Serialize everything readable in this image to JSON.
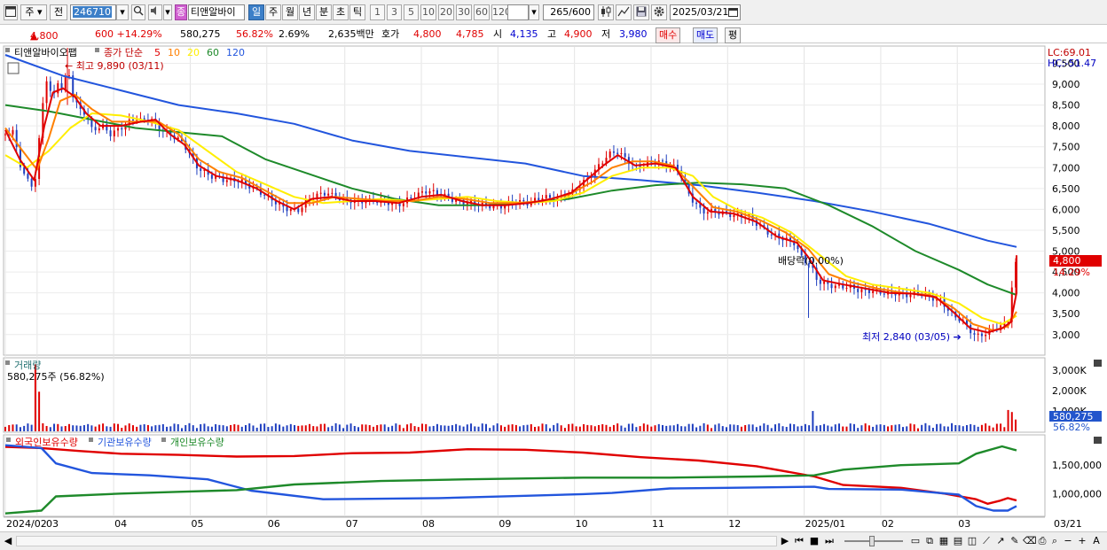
{
  "toolbar": {
    "period_type": "주",
    "prev_label": "전",
    "stock_code": "246710",
    "stock_name": "티앤알바이",
    "timeframes": [
      "일",
      "주",
      "월",
      "년",
      "분",
      "초",
      "틱"
    ],
    "active_timeframe": "일",
    "intervals": [
      "1",
      "3",
      "5",
      "10",
      "20",
      "30",
      "60",
      "120"
    ],
    "count": "265",
    "count_total": "/600",
    "date": "2025/03/21",
    "jong_label": "종"
  },
  "quote": {
    "price": "4,800",
    "change": "600 +14.29%",
    "volume": "580,275",
    "volume_pct": "56.82%",
    "turnover_pct": "2.69%",
    "amount": "2,635백만",
    "hoga_label": "호가",
    "ask": "4,800",
    "bid": "4,785",
    "open_label": "시",
    "open": "4,135",
    "high_label": "고",
    "high": "4,900",
    "low_label": "저",
    "low": "3,980",
    "buy_label": "매수",
    "sell_label": "매도",
    "eval_label": "평"
  },
  "price_panel": {
    "title": "티앤알바이오팹",
    "ma_label": "종가 단순",
    "ma_periods": [
      "5",
      "10",
      "20",
      "60",
      "120"
    ],
    "ma_colors": [
      "#e00000",
      "#ff8000",
      "#ffee00",
      "#1e8a2a",
      "#2255dd"
    ],
    "lc": "LC:69.01",
    "hc": "HC:-51.47",
    "high_annotation": "최고 9,890 (03/11)",
    "low_annotation": "최저 2,840 (03/05)",
    "dividend_annotation": "배당락(0.00%)",
    "current_tag": "4,800",
    "current_pct": "14.29%",
    "y_ticks": [
      "9,500",
      "9,000",
      "8,500",
      "8,000",
      "7,500",
      "7,000",
      "6,500",
      "6,000",
      "5,500",
      "5,000",
      "4,500",
      "4,000",
      "3,500",
      "3,000"
    ]
  },
  "volume_panel": {
    "title": "거래량",
    "subtitle": "580,275주 (56.82%)",
    "y_ticks": [
      "3,000K",
      "2,000K",
      "1,000K"
    ],
    "current_tag": "580,275",
    "current_pct": "56.82%"
  },
  "holder_panel": {
    "series": [
      "외국인보유수량",
      "기관보유수량",
      "개인보유수량"
    ],
    "series_colors": [
      "#e00000",
      "#2255dd",
      "#1e8a2a"
    ],
    "y_ticks": [
      "1,500,000",
      "1,000,000"
    ]
  },
  "x_axis": {
    "labels": [
      "2024/02",
      "03",
      "04",
      "05",
      "06",
      "07",
      "08",
      "09",
      "10",
      "11",
      "12",
      "2025/01",
      "02",
      "03"
    ],
    "right_label": "03/21"
  },
  "chart_data": {
    "type": "line",
    "xlabel": "",
    "ylabel": "",
    "price_range": [
      2550,
      9870
    ],
    "volume_range": [
      0,
      3400
    ],
    "holder_range": [
      630000,
      1970000
    ],
    "price_close": [
      [
        0,
        7800
      ],
      [
        5,
        7900
      ],
      [
        10,
        7100
      ],
      [
        15,
        6700
      ],
      [
        20,
        6500
      ],
      [
        25,
        8200
      ],
      [
        28,
        9200
      ],
      [
        33,
        8600
      ],
      [
        36,
        9100
      ],
      [
        40,
        8800
      ],
      [
        43,
        9450
      ],
      [
        47,
        8700
      ],
      [
        51,
        8400
      ],
      [
        56,
        8300
      ],
      [
        60,
        7900
      ],
      [
        67,
        8000
      ],
      [
        73,
        7800
      ],
      [
        82,
        8000
      ],
      [
        90,
        8200
      ],
      [
        95,
        8100
      ],
      [
        100,
        8200
      ],
      [
        106,
        7950
      ],
      [
        114,
        7800
      ],
      [
        123,
        7600
      ],
      [
        133,
        7000
      ],
      [
        142,
        6800
      ],
      [
        152,
        6700
      ],
      [
        162,
        6700
      ],
      [
        172,
        6500
      ],
      [
        182,
        6300
      ],
      [
        192,
        6050
      ],
      [
        202,
        5950
      ],
      [
        212,
        6300
      ],
      [
        222,
        6400
      ],
      [
        232,
        6250
      ],
      [
        242,
        6200
      ],
      [
        252,
        6200
      ],
      [
        262,
        6200
      ],
      [
        272,
        6100
      ],
      [
        282,
        6300
      ],
      [
        292,
        6450
      ],
      [
        302,
        6350
      ],
      [
        312,
        6200
      ],
      [
        322,
        6150
      ],
      [
        332,
        6100
      ],
      [
        342,
        6050
      ],
      [
        352,
        6200
      ],
      [
        362,
        6150
      ],
      [
        372,
        6300
      ],
      [
        382,
        6250
      ],
      [
        392,
        6400
      ],
      [
        402,
        6700
      ],
      [
        410,
        7000
      ],
      [
        417,
        7300
      ],
      [
        423,
        7400
      ],
      [
        430,
        7200
      ],
      [
        436,
        7000
      ],
      [
        442,
        7050
      ],
      [
        450,
        7150
      ],
      [
        458,
        7100
      ],
      [
        466,
        6950
      ],
      [
        474,
        6300
      ],
      [
        482,
        5950
      ],
      [
        490,
        5950
      ],
      [
        498,
        5900
      ],
      [
        506,
        5850
      ],
      [
        514,
        5850
      ],
      [
        522,
        5600
      ],
      [
        530,
        5400
      ],
      [
        538,
        5300
      ],
      [
        546,
        5200
      ],
      [
        552,
        4800
      ],
      [
        557,
        4700
      ],
      [
        562,
        4300
      ],
      [
        568,
        4200
      ],
      [
        576,
        4150
      ],
      [
        584,
        4150
      ],
      [
        592,
        4050
      ],
      [
        600,
        4050
      ],
      [
        608,
        4000
      ],
      [
        616,
        4000
      ],
      [
        624,
        3950
      ],
      [
        632,
        4000
      ],
      [
        640,
        3900
      ],
      [
        648,
        3800
      ],
      [
        656,
        3450
      ],
      [
        662,
        3350
      ],
      [
        668,
        3100
      ],
      [
        672,
        2950
      ],
      [
        676,
        3000
      ],
      [
        680,
        3050
      ],
      [
        685,
        3150
      ],
      [
        690,
        3200
      ],
      [
        694,
        3300
      ],
      [
        697,
        4200
      ],
      [
        700,
        4800
      ]
    ],
    "ma5": [
      [
        0,
        7900
      ],
      [
        10,
        7200
      ],
      [
        20,
        6700
      ],
      [
        27,
        8000
      ],
      [
        33,
        8800
      ],
      [
        40,
        8900
      ],
      [
        48,
        8700
      ],
      [
        56,
        8300
      ],
      [
        66,
        8000
      ],
      [
        80,
        8000
      ],
      [
        94,
        8100
      ],
      [
        104,
        8150
      ],
      [
        114,
        7800
      ],
      [
        124,
        7550
      ],
      [
        134,
        7050
      ],
      [
        146,
        6800
      ],
      [
        160,
        6700
      ],
      [
        174,
        6500
      ],
      [
        188,
        6200
      ],
      [
        200,
        6000
      ],
      [
        212,
        6250
      ],
      [
        226,
        6300
      ],
      [
        240,
        6200
      ],
      [
        256,
        6200
      ],
      [
        272,
        6150
      ],
      [
        288,
        6300
      ],
      [
        302,
        6350
      ],
      [
        316,
        6200
      ],
      [
        330,
        6100
      ],
      [
        346,
        6100
      ],
      [
        362,
        6150
      ],
      [
        378,
        6250
      ],
      [
        392,
        6400
      ],
      [
        404,
        6750
      ],
      [
        414,
        7050
      ],
      [
        424,
        7300
      ],
      [
        436,
        7050
      ],
      [
        450,
        7100
      ],
      [
        464,
        7000
      ],
      [
        476,
        6300
      ],
      [
        488,
        5950
      ],
      [
        504,
        5900
      ],
      [
        520,
        5700
      ],
      [
        534,
        5350
      ],
      [
        548,
        5200
      ],
      [
        556,
        4850
      ],
      [
        566,
        4300
      ],
      [
        580,
        4200
      ],
      [
        596,
        4100
      ],
      [
        612,
        4000
      ],
      [
        628,
        3980
      ],
      [
        644,
        3900
      ],
      [
        656,
        3550
      ],
      [
        668,
        3150
      ],
      [
        680,
        3050
      ],
      [
        690,
        3150
      ],
      [
        696,
        3300
      ],
      [
        700,
        4000
      ]
    ],
    "ma10": [
      [
        0,
        7950
      ],
      [
        12,
        7400
      ],
      [
        22,
        6950
      ],
      [
        30,
        7700
      ],
      [
        38,
        8600
      ],
      [
        48,
        8750
      ],
      [
        60,
        8400
      ],
      [
        74,
        8100
      ],
      [
        90,
        8100
      ],
      [
        106,
        8100
      ],
      [
        120,
        7800
      ],
      [
        134,
        7200
      ],
      [
        148,
        6900
      ],
      [
        164,
        6750
      ],
      [
        180,
        6450
      ],
      [
        196,
        6150
      ],
      [
        212,
        6150
      ],
      [
        228,
        6300
      ],
      [
        246,
        6250
      ],
      [
        264,
        6200
      ],
      [
        282,
        6200
      ],
      [
        300,
        6300
      ],
      [
        318,
        6250
      ],
      [
        336,
        6150
      ],
      [
        354,
        6150
      ],
      [
        372,
        6200
      ],
      [
        390,
        6350
      ],
      [
        406,
        6650
      ],
      [
        420,
        7000
      ],
      [
        434,
        7150
      ],
      [
        448,
        7150
      ],
      [
        462,
        7050
      ],
      [
        476,
        6550
      ],
      [
        490,
        6050
      ],
      [
        506,
        5950
      ],
      [
        522,
        5750
      ],
      [
        540,
        5450
      ],
      [
        556,
        5050
      ],
      [
        570,
        4450
      ],
      [
        586,
        4250
      ],
      [
        604,
        4100
      ],
      [
        622,
        4000
      ],
      [
        640,
        3950
      ],
      [
        656,
        3650
      ],
      [
        670,
        3250
      ],
      [
        684,
        3100
      ],
      [
        694,
        3200
      ],
      [
        700,
        3550
      ]
    ],
    "ma20": [
      [
        0,
        7300
      ],
      [
        15,
        7000
      ],
      [
        30,
        7400
      ],
      [
        45,
        7950
      ],
      [
        60,
        8300
      ],
      [
        80,
        8250
      ],
      [
        100,
        8100
      ],
      [
        120,
        7900
      ],
      [
        140,
        7400
      ],
      [
        160,
        6900
      ],
      [
        180,
        6600
      ],
      [
        200,
        6300
      ],
      [
        220,
        6150
      ],
      [
        240,
        6200
      ],
      [
        260,
        6250
      ],
      [
        280,
        6200
      ],
      [
        300,
        6250
      ],
      [
        320,
        6300
      ],
      [
        340,
        6200
      ],
      [
        360,
        6150
      ],
      [
        380,
        6200
      ],
      [
        400,
        6400
      ],
      [
        420,
        6800
      ],
      [
        440,
        7000
      ],
      [
        460,
        7000
      ],
      [
        476,
        6800
      ],
      [
        490,
        6300
      ],
      [
        506,
        6000
      ],
      [
        524,
        5800
      ],
      [
        544,
        5450
      ],
      [
        564,
        4900
      ],
      [
        582,
        4400
      ],
      [
        600,
        4200
      ],
      [
        620,
        4100
      ],
      [
        640,
        4000
      ],
      [
        660,
        3750
      ],
      [
        676,
        3400
      ],
      [
        690,
        3250
      ],
      [
        700,
        3450
      ]
    ],
    "ma60": [
      [
        0,
        8500
      ],
      [
        30,
        8350
      ],
      [
        60,
        8150
      ],
      [
        90,
        7950
      ],
      [
        120,
        7850
      ],
      [
        150,
        7750
      ],
      [
        180,
        7200
      ],
      [
        210,
        6850
      ],
      [
        240,
        6500
      ],
      [
        270,
        6250
      ],
      [
        300,
        6100
      ],
      [
        330,
        6100
      ],
      [
        360,
        6150
      ],
      [
        390,
        6250
      ],
      [
        420,
        6450
      ],
      [
        450,
        6580
      ],
      [
        480,
        6640
      ],
      [
        510,
        6600
      ],
      [
        540,
        6500
      ],
      [
        570,
        6100
      ],
      [
        600,
        5600
      ],
      [
        630,
        5000
      ],
      [
        660,
        4550
      ],
      [
        680,
        4200
      ],
      [
        700,
        3950
      ]
    ],
    "ma120": [
      [
        0,
        9700
      ],
      [
        40,
        9200
      ],
      [
        80,
        8850
      ],
      [
        120,
        8500
      ],
      [
        160,
        8300
      ],
      [
        200,
        8050
      ],
      [
        240,
        7650
      ],
      [
        280,
        7400
      ],
      [
        320,
        7250
      ],
      [
        360,
        7100
      ],
      [
        400,
        6800
      ],
      [
        440,
        6700
      ],
      [
        480,
        6580
      ],
      [
        520,
        6400
      ],
      [
        560,
        6200
      ],
      [
        600,
        5950
      ],
      [
        640,
        5650
      ],
      [
        680,
        5250
      ],
      [
        700,
        5100
      ]
    ],
    "volume_spikes": [
      [
        21,
        3300
      ],
      [
        24,
        1950
      ],
      [
        558,
        1000
      ],
      [
        656,
        400
      ],
      [
        694,
        1050
      ],
      [
        697,
        950
      ],
      [
        700,
        580
      ]
    ],
    "foreign_holding": [
      [
        0,
        1820
      ],
      [
        25,
        1800
      ],
      [
        50,
        1750
      ],
      [
        80,
        1700
      ],
      [
        120,
        1680
      ],
      [
        160,
        1650
      ],
      [
        200,
        1660
      ],
      [
        240,
        1710
      ],
      [
        280,
        1720
      ],
      [
        320,
        1780
      ],
      [
        360,
        1770
      ],
      [
        400,
        1720
      ],
      [
        440,
        1640
      ],
      [
        480,
        1580
      ],
      [
        520,
        1480
      ],
      [
        560,
        1300
      ],
      [
        580,
        1150
      ],
      [
        620,
        1100
      ],
      [
        650,
        1000
      ],
      [
        672,
        900
      ],
      [
        680,
        820
      ],
      [
        688,
        870
      ],
      [
        694,
        920
      ],
      [
        700,
        880
      ]
    ],
    "institution_holding": [
      [
        0,
        1850
      ],
      [
        25,
        1800
      ],
      [
        35,
        1530
      ],
      [
        60,
        1360
      ],
      [
        100,
        1320
      ],
      [
        140,
        1250
      ],
      [
        170,
        1050
      ],
      [
        220,
        900
      ],
      [
        300,
        920
      ],
      [
        360,
        960
      ],
      [
        400,
        990
      ],
      [
        420,
        1010
      ],
      [
        460,
        1090
      ],
      [
        500,
        1100
      ],
      [
        560,
        1120
      ],
      [
        570,
        1080
      ],
      [
        620,
        1070
      ],
      [
        660,
        980
      ],
      [
        672,
        780
      ],
      [
        684,
        700
      ],
      [
        694,
        700
      ],
      [
        700,
        780
      ]
    ],
    "individual_holding": [
      [
        0,
        650
      ],
      [
        25,
        700
      ],
      [
        35,
        950
      ],
      [
        80,
        1000
      ],
      [
        120,
        1030
      ],
      [
        160,
        1060
      ],
      [
        200,
        1160
      ],
      [
        260,
        1220
      ],
      [
        320,
        1250
      ],
      [
        400,
        1280
      ],
      [
        460,
        1280
      ],
      [
        520,
        1300
      ],
      [
        560,
        1320
      ],
      [
        580,
        1420
      ],
      [
        620,
        1500
      ],
      [
        660,
        1530
      ],
      [
        672,
        1700
      ],
      [
        690,
        1830
      ],
      [
        700,
        1760
      ]
    ]
  }
}
